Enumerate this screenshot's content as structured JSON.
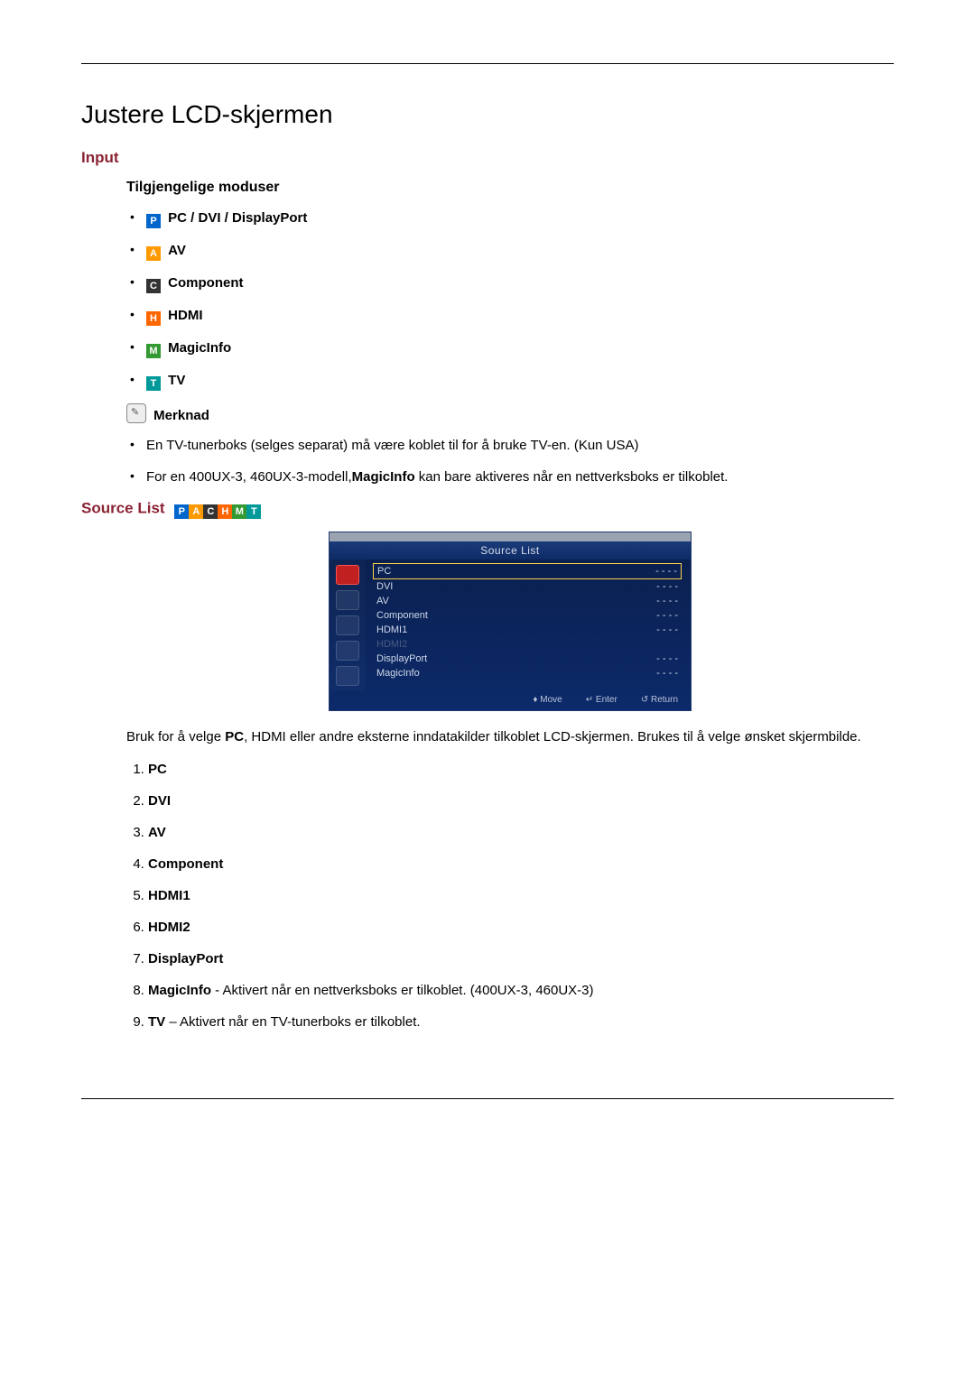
{
  "title": "Justere LCD-skjermen",
  "input_heading": "Input",
  "available_modes_heading": "Tilgjengelige moduser",
  "modes": {
    "pc": {
      "letter": "P",
      "label": "PC / DVI / DisplayPort"
    },
    "av": {
      "letter": "A",
      "label": "AV"
    },
    "component": {
      "letter": "C",
      "label": "Component"
    },
    "hdmi": {
      "letter": "H",
      "label": "HDMI"
    },
    "magicinfo": {
      "letter": "M",
      "label": "MagicInfo"
    },
    "tv": {
      "letter": "T",
      "label": "TV"
    }
  },
  "note_label": "Merknad",
  "notes": {
    "n1": "En TV-tunerboks (selges separat) må være koblet til for å bruke TV-en. (Kun USA)",
    "n2_a": "For en 400UX-3, 460UX-3-modell,",
    "n2_b": "MagicInfo",
    "n2_c": " kan bare aktiveres når en nettverksboks er tilkoblet."
  },
  "source_list_heading": "Source List",
  "osd": {
    "title": "Source List",
    "rows": {
      "pc": {
        "label": "PC",
        "value": "- - - -",
        "selected": true
      },
      "dvi": {
        "label": "DVI",
        "value": "- - - -"
      },
      "av": {
        "label": "AV",
        "value": "- - - -"
      },
      "component": {
        "label": "Component",
        "value": "- - - -"
      },
      "hdmi1": {
        "label": "HDMI1",
        "value": "- - - -"
      },
      "hdmi2": {
        "label": "HDMI2",
        "value": "",
        "disabled": true
      },
      "displayport": {
        "label": "DisplayPort",
        "value": "- - - -"
      },
      "magicinfo": {
        "label": "MagicInfo",
        "value": "- - - -"
      }
    },
    "footer": {
      "move": "Move",
      "enter": "Enter",
      "return": "Return"
    }
  },
  "source_body_a": "Bruk for å velge ",
  "source_body_b": "PC",
  "source_body_c": ", HDMI eller andre eksterne inndatakilder tilkoblet LCD-skjermen. Brukes til å velge ønsket skjermbilde.",
  "sources": {
    "s1": "PC",
    "s2": "DVI",
    "s3": "AV",
    "s4": "Component",
    "s5": "HDMI1",
    "s6": "HDMI2",
    "s7": "DisplayPort",
    "s8_a": "MagicInfo",
    "s8_b": " - Aktivert når en nettverksboks er tilkoblet. (400UX-3, 460UX-3)",
    "s9_a": "TV",
    "s9_b": " – Aktivert når en TV-tunerboks er tilkoblet."
  }
}
